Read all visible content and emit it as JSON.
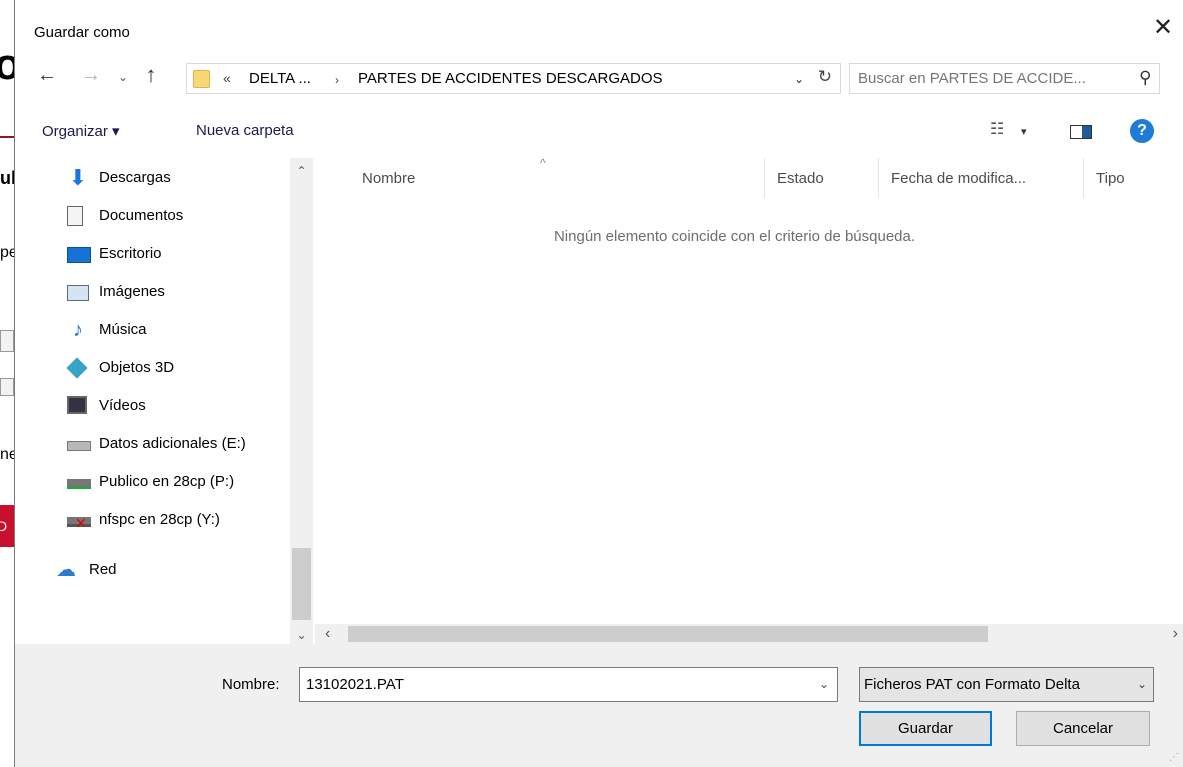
{
  "background_app": {
    "fragments": [
      "o",
      "ul",
      "pe",
      "ne",
      "D"
    ]
  },
  "dialog": {
    "title": "Guardar como",
    "close_glyph": "✕"
  },
  "nav": {
    "back": "←",
    "forward": "→",
    "recent": "⌄",
    "up": "↑"
  },
  "address": {
    "chevron": "«",
    "crumbs": [
      "DELTA ...",
      "PARTES DE ACCIDENTES DESCARGADOS"
    ],
    "separator": "›",
    "dropdown": "⌄",
    "refresh": "↻"
  },
  "search": {
    "placeholder": "Buscar en PARTES DE ACCIDE...",
    "icon": "⚲"
  },
  "toolbar": {
    "organizar": "Organizar ▾",
    "nueva_carpeta": "Nueva carpeta",
    "view_glyph": "☷",
    "view_dropdown": "▾",
    "help": "?"
  },
  "sidebar": {
    "items": [
      {
        "label": "Descargas",
        "icon": "download-icon"
      },
      {
        "label": "Documentos",
        "icon": "document-icon"
      },
      {
        "label": "Escritorio",
        "icon": "desktop-icon"
      },
      {
        "label": "Imágenes",
        "icon": "pictures-icon"
      },
      {
        "label": "Música",
        "icon": "music-icon"
      },
      {
        "label": "Objetos 3D",
        "icon": "3d-objects-icon"
      },
      {
        "label": "Vídeos",
        "icon": "videos-icon"
      },
      {
        "label": "Datos adicionales (E:)",
        "icon": "drive-icon"
      },
      {
        "label": "Publico en 28cp (P:)",
        "icon": "network-drive-icon"
      },
      {
        "label": "nfspc en 28cp (Y:)",
        "icon": "disconnected-drive-icon"
      }
    ],
    "network": {
      "label": "Red",
      "icon": "network-icon"
    },
    "scroll_up": "⌃",
    "scroll_down": "⌄"
  },
  "content": {
    "columns": [
      "Nombre",
      "Estado",
      "Fecha de modifica...",
      "Tipo"
    ],
    "sort_glyph": "^",
    "empty_message": "Ningún elemento coincide con el criterio de búsqueda.",
    "scroll_left": "‹",
    "scroll_right": "›"
  },
  "footer": {
    "name_label": "Nombre:",
    "file_name": "13102021.PAT",
    "name_dropdown": "⌄",
    "file_type": "Ficheros PAT con Formato Delta",
    "type_dropdown": "⌄",
    "save_label": "Guardar",
    "cancel_label": "Cancelar"
  }
}
